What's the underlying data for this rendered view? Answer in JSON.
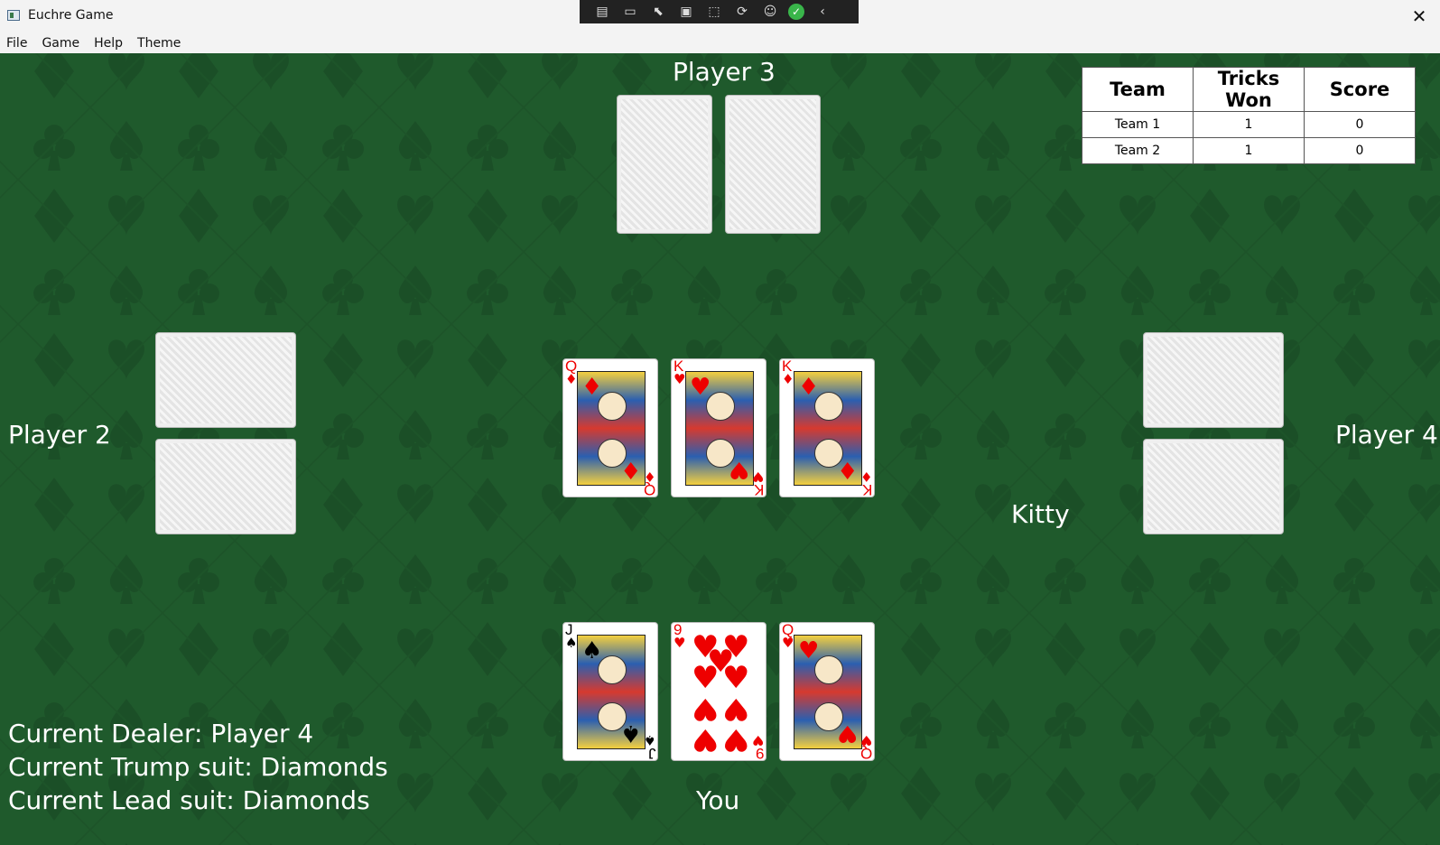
{
  "window": {
    "title": "Euchre Game",
    "close_label": "✕"
  },
  "menu": {
    "items": [
      "File",
      "Game",
      "Help",
      "Theme"
    ]
  },
  "debug_toolbar": {
    "icons": [
      "live-visual-tree-icon",
      "record-icon",
      "select-element-icon",
      "display-layout-adorners-icon",
      "track-focus-icon",
      "hot-reload-icon",
      "accessibility-icon",
      "binding-check-icon",
      "collapse-icon"
    ]
  },
  "players": {
    "top": "Player 3",
    "left": "Player 2",
    "right": "Player 4",
    "bottom": "You",
    "kitty": "Kitty"
  },
  "trick_cards": [
    {
      "rank": "Q",
      "suit": "♦",
      "color": "red",
      "face": true
    },
    {
      "rank": "K",
      "suit": "♥",
      "color": "red",
      "face": true
    },
    {
      "rank": "K",
      "suit": "♦",
      "color": "red",
      "face": true
    }
  ],
  "hand_cards": [
    {
      "rank": "J",
      "suit": "♠",
      "color": "black",
      "face": true
    },
    {
      "rank": "9",
      "suit": "♥",
      "color": "red",
      "face": false
    },
    {
      "rank": "Q",
      "suit": "♥",
      "color": "red",
      "face": true
    }
  ],
  "scoreboard": {
    "headers": [
      "Team",
      "Tricks Won",
      "Score"
    ],
    "rows": [
      [
        "Team 1",
        "1",
        "0"
      ],
      [
        "Team 2",
        "1",
        "0"
      ]
    ]
  },
  "status": {
    "dealer": "Current Dealer: Player 4",
    "trump": "Current Trump suit: Diamonds",
    "lead": "Current Lead suit: Diamonds"
  },
  "colors": {
    "table_green": "#1f5a2c",
    "card_red": "#e00000"
  }
}
